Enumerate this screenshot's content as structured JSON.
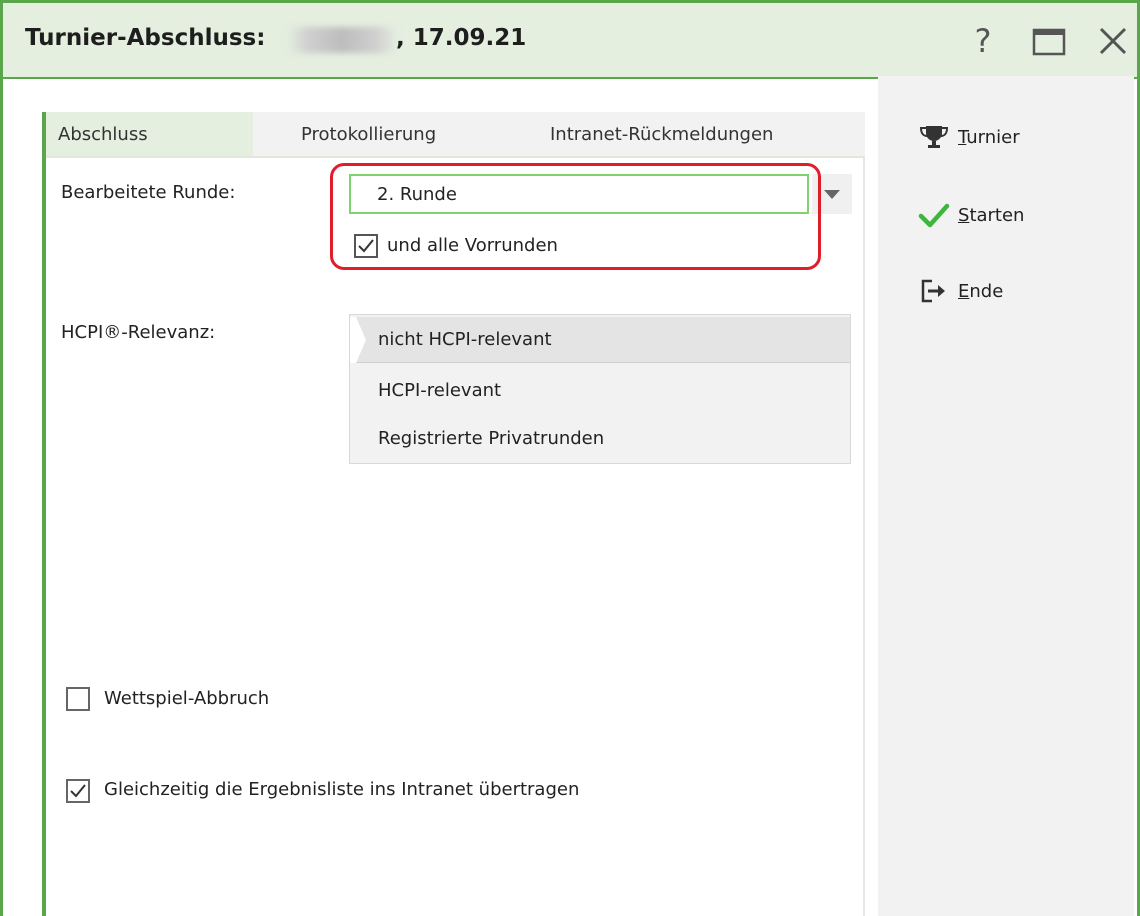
{
  "window": {
    "title_prefix": "Turnier-Abschluss:",
    "title_suffix": ", 17.09.21"
  },
  "titlebar_buttons": {
    "help": "?",
    "maximize": "maximize",
    "close": "close"
  },
  "tabs": [
    {
      "label": "Abschluss",
      "active": true
    },
    {
      "label": "Protokollierung",
      "active": false
    },
    {
      "label": "Intranet-Rückmeldungen",
      "active": false
    }
  ],
  "form": {
    "round_label": "Bearbeitete Runde:",
    "round_value": "2. Runde",
    "all_prelim_label": "und alle Vorrunden",
    "all_prelim_checked": true,
    "hcpi_label": "HCPI®-Relevanz:",
    "hcpi_options": [
      "nicht HCPI-relevant",
      "HCPI-relevant",
      "Registrierte Privatrunden"
    ],
    "hcpi_selected": "nicht HCPI-relevant",
    "abort_label": "Wettspiel-Abbruch",
    "abort_checked": false,
    "transfer_label": "Gleichzeitig die Ergebnisliste ins Intranet übertragen",
    "transfer_checked": true
  },
  "actions": [
    {
      "first": "T",
      "rest": "urnier",
      "icon": "trophy-icon"
    },
    {
      "first": "S",
      "rest": "tarten",
      "icon": "checkmark-icon"
    },
    {
      "first": "E",
      "rest": "nde",
      "icon": "exit-icon"
    }
  ],
  "colors": {
    "accent_green": "#5aa64a",
    "title_bg": "#e4efe0",
    "highlight_red": "#e21d28",
    "check_green": "#3cb63c"
  }
}
